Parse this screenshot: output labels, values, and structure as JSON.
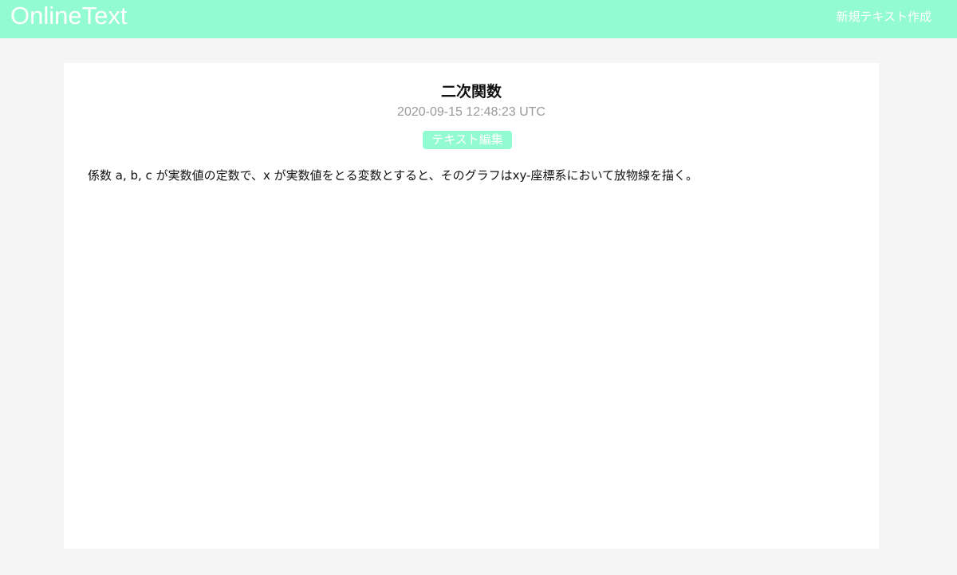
{
  "header": {
    "brand": "OnlineText",
    "new_text_link": "新規テキスト作成"
  },
  "document": {
    "title": "二次関数",
    "timestamp": "2020-09-15 12:48:23 UTC",
    "edit_button": "テキスト編集",
    "body": "係数 a, b, c が実数値の定数で、x が実数値をとる変数とすると、そのグラフはxy-座標系において放物線を描く。"
  },
  "colors": {
    "accent": "#93fbd1",
    "page_background": "#f5f5f5",
    "card_background": "#ffffff",
    "timestamp_text": "#9a9a9a"
  }
}
